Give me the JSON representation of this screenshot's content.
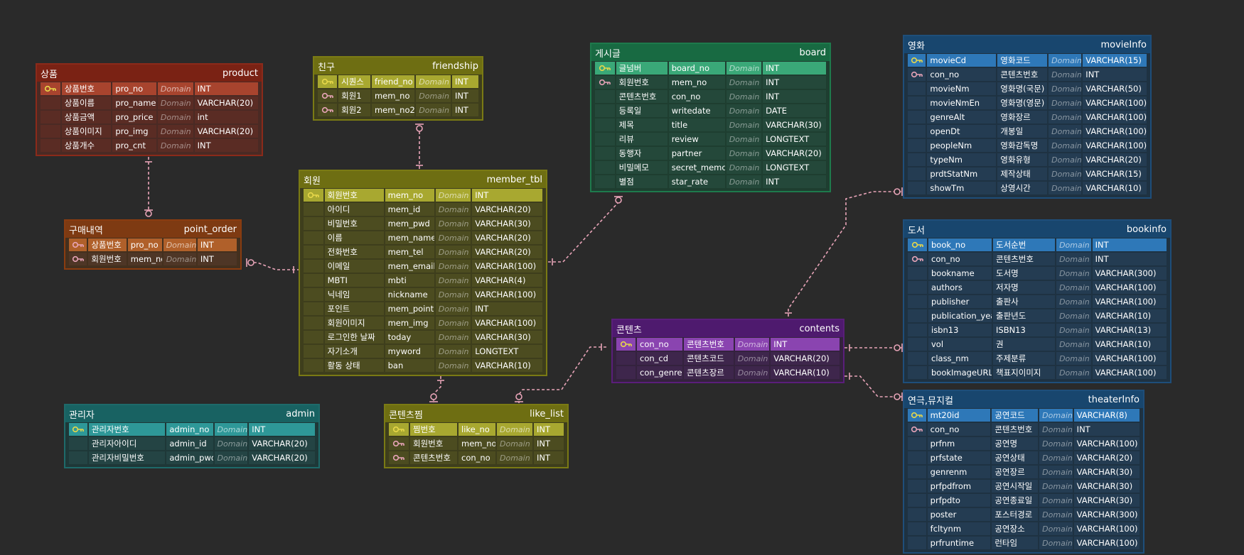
{
  "tables": {
    "product": {
      "label": "상품",
      "name": "product",
      "rows": [
        {
          "key": "pk",
          "kr": "상품번호",
          "col": "pro_no",
          "dom": "Domain",
          "type": "INT"
        },
        {
          "key": "",
          "kr": "상품이름",
          "col": "pro_name",
          "dom": "Domain",
          "type": "VARCHAR(20)"
        },
        {
          "key": "",
          "kr": "상품금액",
          "col": "pro_price",
          "dom": "Domain",
          "type": "int"
        },
        {
          "key": "",
          "kr": "상품이미지",
          "col": "pro_img",
          "dom": "Domain",
          "type": "VARCHAR(20)"
        },
        {
          "key": "",
          "kr": "상품개수",
          "col": "pro_cnt",
          "dom": "Domain",
          "type": "INT"
        }
      ]
    },
    "friendship": {
      "label": "친구",
      "name": "friendship",
      "rows": [
        {
          "key": "pk",
          "kr": "시퀀스",
          "col": "friend_no",
          "dom": "Domain",
          "type": "INT"
        },
        {
          "key": "fk",
          "kr": "회원1",
          "col": "mem_no",
          "dom": "Domain",
          "type": "INT"
        },
        {
          "key": "fk",
          "kr": "회원2",
          "col": "mem_no2",
          "dom": "Domain",
          "type": "INT"
        }
      ]
    },
    "board": {
      "label": "게시글",
      "name": "board",
      "rows": [
        {
          "key": "pk",
          "kr": "글넘버",
          "col": "board_no",
          "dom": "Domain",
          "type": "INT"
        },
        {
          "key": "fk",
          "kr": "회원번호",
          "col": "mem_no",
          "dom": "Domain",
          "type": "INT"
        },
        {
          "key": "",
          "kr": "콘텐츠번호",
          "col": "con_no",
          "dom": "Domain",
          "type": "INT"
        },
        {
          "key": "",
          "kr": "등록일",
          "col": "writedate",
          "dom": "Domain",
          "type": "DATE"
        },
        {
          "key": "",
          "kr": "제목",
          "col": "title",
          "dom": "Domain",
          "type": "VARCHAR(30)"
        },
        {
          "key": "",
          "kr": "리뷰",
          "col": "review",
          "dom": "Domain",
          "type": "LONGTEXT"
        },
        {
          "key": "",
          "kr": "동행자",
          "col": "partner",
          "dom": "Domain",
          "type": "VARCHAR(20)"
        },
        {
          "key": "",
          "kr": "비밀메모",
          "col": "secret_memo",
          "dom": "Domain",
          "type": "LONGTEXT"
        },
        {
          "key": "",
          "kr": "별점",
          "col": "star_rate",
          "dom": "Domain",
          "type": "INT"
        }
      ]
    },
    "movieInfo": {
      "label": "영화",
      "name": "movieInfo",
      "rows": [
        {
          "key": "pk",
          "kr": "movieCd",
          "col": "영화코드",
          "dom": "Domain",
          "type": "VARCHAR(15)"
        },
        {
          "key": "fk",
          "kr": "con_no",
          "col": "콘텐츠번호",
          "dom": "Domain",
          "type": "INT"
        },
        {
          "key": "",
          "kr": "movieNm",
          "col": "영화명(국문)",
          "dom": "Domain",
          "type": "VARCHAR(50)"
        },
        {
          "key": "",
          "kr": "movieNmEn",
          "col": "영화명(영문)",
          "dom": "Domain",
          "type": "VARCHAR(100)"
        },
        {
          "key": "",
          "kr": "genreAlt",
          "col": "영화장르",
          "dom": "Domain",
          "type": "VARCHAR(100)"
        },
        {
          "key": "",
          "kr": "openDt",
          "col": "개봉일",
          "dom": "Domain",
          "type": "VARCHAR(100)"
        },
        {
          "key": "",
          "kr": "peopleNm",
          "col": "영화감독명",
          "dom": "Domain",
          "type": "VARCHAR(100)"
        },
        {
          "key": "",
          "kr": "typeNm",
          "col": "영화유형",
          "dom": "Domain",
          "type": "VARCHAR(20)"
        },
        {
          "key": "",
          "kr": "prdtStatNm",
          "col": "제작상태",
          "dom": "Domain",
          "type": "VARCHAR(15)"
        },
        {
          "key": "",
          "kr": "showTm",
          "col": "상영시간",
          "dom": "Domain",
          "type": "VARCHAR(10)"
        }
      ]
    },
    "point_order": {
      "label": "구매내역",
      "name": "point_order",
      "rows": [
        {
          "key": "fk",
          "kr": "상품번호",
          "col": "pro_no",
          "dom": "Domain",
          "type": "INT"
        },
        {
          "key": "fk",
          "kr": "회원번호",
          "col": "mem_no",
          "dom": "Domain",
          "type": "INT"
        }
      ]
    },
    "member_tbl": {
      "label": "회원",
      "name": "member_tbl",
      "rows": [
        {
          "key": "pk",
          "kr": "회원번호",
          "col": "mem_no",
          "dom": "Domain",
          "type": "INT"
        },
        {
          "key": "",
          "kr": "아이디",
          "col": "mem_id",
          "dom": "Domain",
          "type": "VARCHAR(20)"
        },
        {
          "key": "",
          "kr": "비밀번호",
          "col": "mem_pwd",
          "dom": "Domain",
          "type": "VARCHAR(30)"
        },
        {
          "key": "",
          "kr": "이름",
          "col": "mem_name",
          "dom": "Domain",
          "type": "VARCHAR(20)"
        },
        {
          "key": "",
          "kr": "전화번호",
          "col": "mem_tel",
          "dom": "Domain",
          "type": "VARCHAR(20)"
        },
        {
          "key": "",
          "kr": "이메일",
          "col": "mem_email",
          "dom": "Domain",
          "type": "VARCHAR(100)"
        },
        {
          "key": "",
          "kr": "MBTI",
          "col": "mbti",
          "dom": "Domain",
          "type": "VARCHAR(4)"
        },
        {
          "key": "",
          "kr": "닉네임",
          "col": "nickname",
          "dom": "Domain",
          "type": "VARCHAR(100)"
        },
        {
          "key": "",
          "kr": "포인트",
          "col": "mem_point",
          "dom": "Domain",
          "type": "INT"
        },
        {
          "key": "",
          "kr": "회원이미지",
          "col": "mem_img",
          "dom": "Domain",
          "type": "VARCHAR(100)"
        },
        {
          "key": "",
          "kr": "로그인한 날짜",
          "col": "today",
          "dom": "Domain",
          "type": "VARCHAR(30)"
        },
        {
          "key": "",
          "kr": "자기소개",
          "col": "myword",
          "dom": "Domain",
          "type": "LONGTEXT"
        },
        {
          "key": "",
          "kr": "활동 상태",
          "col": "ban",
          "dom": "Domain",
          "type": "VARCHAR(10)"
        }
      ]
    },
    "bookinfo": {
      "label": "도서",
      "name": "bookinfo",
      "rows": [
        {
          "key": "pk",
          "kr": "book_no",
          "col": "도서순번",
          "dom": "Domain",
          "type": "INT"
        },
        {
          "key": "fk",
          "kr": "con_no",
          "col": "콘텐츠번호",
          "dom": "Domain",
          "type": "INT"
        },
        {
          "key": "",
          "kr": "bookname",
          "col": "도서명",
          "dom": "Domain",
          "type": "VARCHAR(300)"
        },
        {
          "key": "",
          "kr": "authors",
          "col": "저자명",
          "dom": "Domain",
          "type": "VARCHAR(100)"
        },
        {
          "key": "",
          "kr": "publisher",
          "col": "출판사",
          "dom": "Domain",
          "type": "VARCHAR(100)"
        },
        {
          "key": "",
          "kr": "publication_year",
          "col": "출판년도",
          "dom": "Domain",
          "type": "VARCHAR(10)"
        },
        {
          "key": "",
          "kr": "isbn13",
          "col": "ISBN13",
          "dom": "Domain",
          "type": "VARCHAR(13)"
        },
        {
          "key": "",
          "kr": "vol",
          "col": "권",
          "dom": "Domain",
          "type": "VARCHAR(10)"
        },
        {
          "key": "",
          "kr": "class_nm",
          "col": "주제분류",
          "dom": "Domain",
          "type": "VARCHAR(100)"
        },
        {
          "key": "",
          "kr": "bookImageURL",
          "col": "책표지이미지",
          "dom": "Domain",
          "type": "VARCHAR(100)"
        }
      ]
    },
    "contents": {
      "label": "콘텐츠",
      "name": "contents",
      "rows": [
        {
          "key": "pk",
          "kr": "con_no",
          "col": "콘텐츠번호",
          "dom": "Domain",
          "type": "INT"
        },
        {
          "key": "",
          "kr": "con_cd",
          "col": "콘텐츠코드",
          "dom": "Domain",
          "type": "VARCHAR(20)"
        },
        {
          "key": "",
          "kr": "con_genre",
          "col": "콘텐츠장르",
          "dom": "Domain",
          "type": "VARCHAR(10)"
        }
      ]
    },
    "admin": {
      "label": "관리자",
      "name": "admin",
      "rows": [
        {
          "key": "pk",
          "kr": "관리자번호",
          "col": "admin_no",
          "dom": "Domain",
          "type": "INT"
        },
        {
          "key": "",
          "kr": "관리자아이디",
          "col": "admin_id",
          "dom": "Domain",
          "type": "VARCHAR(20)"
        },
        {
          "key": "",
          "kr": "관리자비밀번호",
          "col": "admin_pwd",
          "dom": "Domain",
          "type": "VARCHAR(20)"
        }
      ]
    },
    "like_list": {
      "label": "콘텐츠찜",
      "name": "like_list",
      "rows": [
        {
          "key": "pk",
          "kr": "찜번호",
          "col": "like_no",
          "dom": "Domain",
          "type": "INT"
        },
        {
          "key": "fk",
          "kr": "회원번호",
          "col": "mem_no",
          "dom": "Domain",
          "type": "INT"
        },
        {
          "key": "fk",
          "kr": "콘텐츠번호",
          "col": "con_no",
          "dom": "Domain",
          "type": "INT"
        }
      ]
    },
    "theaterInfo": {
      "label": "연극,뮤지컬",
      "name": "theaterInfo",
      "rows": [
        {
          "key": "pk",
          "kr": "mt20id",
          "col": "공연코드",
          "dom": "Domain",
          "type": "VARCHAR(8)"
        },
        {
          "key": "fk",
          "kr": "con_no",
          "col": "콘텐츠번호",
          "dom": "Domain",
          "type": "INT"
        },
        {
          "key": "",
          "kr": "prfnm",
          "col": "공연명",
          "dom": "Domain",
          "type": "VARCHAR(100)"
        },
        {
          "key": "",
          "kr": "prfstate",
          "col": "공연상태",
          "dom": "Domain",
          "type": "VARCHAR(20)"
        },
        {
          "key": "",
          "kr": "genrenm",
          "col": "공연장르",
          "dom": "Domain",
          "type": "VARCHAR(30)"
        },
        {
          "key": "",
          "kr": "prfpdfrom",
          "col": "공연시작일",
          "dom": "Domain",
          "type": "VARCHAR(30)"
        },
        {
          "key": "",
          "kr": "prfpdto",
          "col": "공연종료일",
          "dom": "Domain",
          "type": "VARCHAR(30)"
        },
        {
          "key": "",
          "kr": "poster",
          "col": "포스터경로",
          "dom": "Domain",
          "type": "VARCHAR(300)"
        },
        {
          "key": "",
          "kr": "fcltynm",
          "col": "공연장소",
          "dom": "Domain",
          "type": "VARCHAR(100)"
        },
        {
          "key": "",
          "kr": "prfruntime",
          "col": "런타임",
          "dom": "Domain",
          "type": "VARCHAR(100)"
        }
      ]
    }
  },
  "colors": {
    "background": "#2a2a2a",
    "relation_line": "#e8a4b8",
    "key_icon": "#e8d84a",
    "fk_icon": "#e8a4b8"
  }
}
